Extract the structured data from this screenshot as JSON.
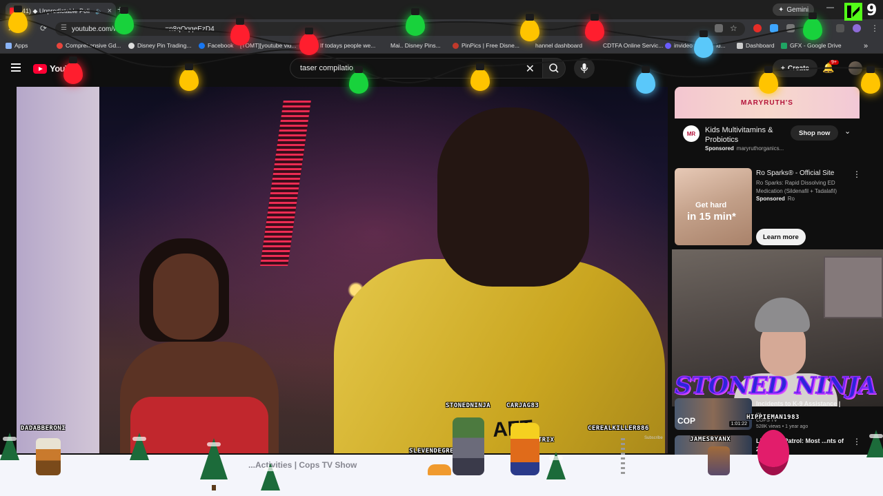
{
  "browser": {
    "tab_title": "(41) ◆ Unpredictable Poli",
    "tab_close": "×",
    "new_tab": "+",
    "gemini_label": "Gemini",
    "url": "youtube.com/w",
    "url_tail": "=n8qOqqeEzD4",
    "bookmarks": [
      "Apps",
      "Comprehensive Gd...",
      "Disney Pin Trading...",
      "Facebook",
      "[TOMT][youtube vid...",
      "If todays people we...",
      "Mai.. Disney Pins...",
      "PinPics | Free Disne...",
      "hannel dashboard",
      "CDTFA Online Servic...",
      "invideo",
      "id...",
      "Dashboard",
      "GFX - Google Drive"
    ]
  },
  "youtube": {
    "logo_text": "YouT",
    "search_value": "taser compilatio",
    "create_label": "Create",
    "notif_count": "9+"
  },
  "ad": {
    "banner_brand": "MARYRUTH'S",
    "logo_text": "MR",
    "title": "Kids Multivitamins & Probiotics",
    "sponsored": "Sponsored",
    "advertiser": "maryruthorganics...",
    "cta": "Shop now"
  },
  "ad2": {
    "title": "Ro Sparks® - Official Site",
    "desc": "Ro Sparks: Rapid Dissolving ED Medication (Sildenafil + Tadalafil)",
    "sponsored": "Sponsored",
    "advertiser": "Ro",
    "thumb_line1": "Get hard",
    "thumb_line2": "in 15 min*",
    "cta": "Learn more"
  },
  "stream": {
    "overlay_title": "STONED NINJA",
    "kick_number": "9"
  },
  "recommendations": [
    {
      "title": "Incidents to K-9 Assistance | ...",
      "channel": "COPS TV",
      "meta": "528K views • 1 year ago",
      "duration": "1:01:22",
      "thumb_tag": "COP"
    },
    {
      "title": "Li... ...ice Patrol: Most ...nts of 2025 | A&E",
      "channel": "",
      "meta": "",
      "duration": "",
      "thumb_tag": ""
    }
  ],
  "chat_overlay": {
    "names": [
      "DADABBERONI",
      "STONEDNINJA",
      "CARJAG83",
      "CEREALKILLER886",
      "SLEVENDEGREE",
      "BOTRIX",
      "HIPPIEMAN1983",
      "JAMESRYANX"
    ],
    "subscribe_hint": "Subscribe"
  },
  "video": {
    "bottom_title": "...Activities | Cops TV Show",
    "shirt_text": "AFT"
  },
  "colors": {
    "accent_red": "#ff0033",
    "kick_green": "#53fc18",
    "overlay_blue": "#2d25d9",
    "bulb_colors": [
      "#ffc400",
      "#18d23c",
      "#ff1e2e",
      "#5ac8fa"
    ]
  }
}
